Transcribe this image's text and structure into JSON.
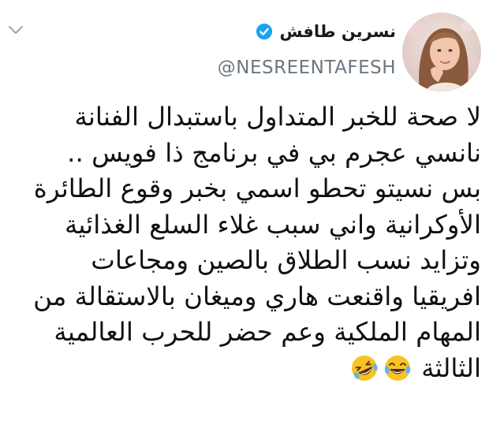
{
  "tweet": {
    "display_name": "نسرين طافش",
    "handle": "@NESREENTAFESH",
    "lines": [
      "لا صحة للخبر المتداول باستبدال الفنانة",
      "نانسي عجرم بي في برنامج ذا فويس ..",
      "بس نسيتو تحطو اسمي بخبر وقوع الطائرة",
      "الأوكرانية واني سبب غلاء السلع الغذائية",
      "وتزايد نسب الطلاق بالصين ومجاعات",
      "افريقيا واقنعت هاري وميغان بالاستقالة من",
      "المهام الملكية وعم حضر للحرب العالمية",
      "الثالثة"
    ],
    "emojis": [
      "rolling-on-floor-laughing-icon",
      "face-with-tears-of-joy-icon"
    ]
  },
  "colors": {
    "verified": "#1da1f2",
    "handle": "#6b7680",
    "text": "#111111",
    "emoji_yellow": "#f7c325"
  }
}
